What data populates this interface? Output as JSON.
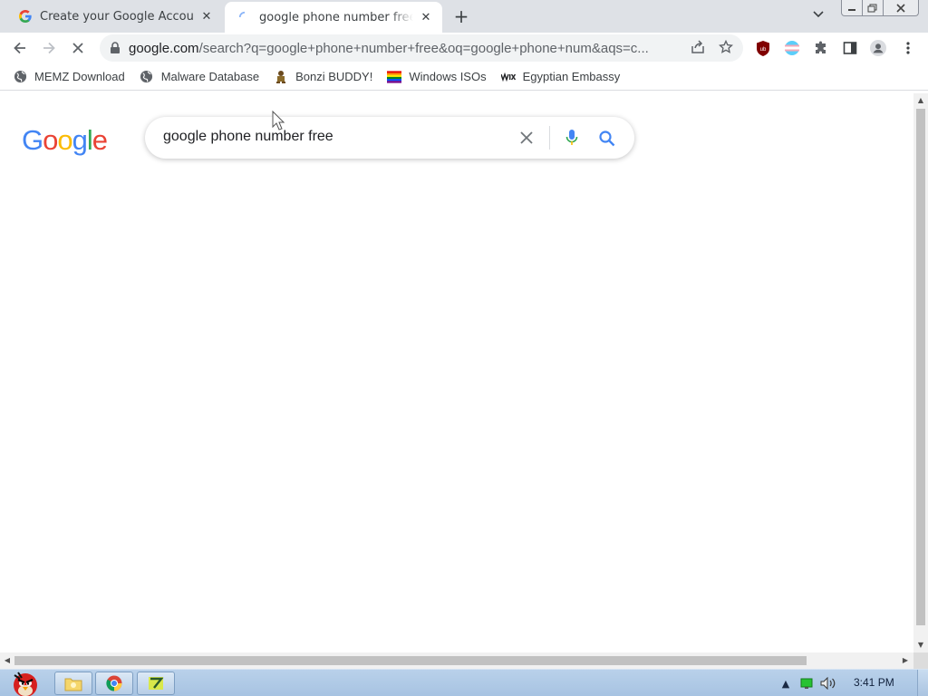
{
  "tabs": [
    {
      "title": "Create your Google Account",
      "active": false,
      "favicon": "google-g-icon"
    },
    {
      "title": "google phone number free - Google Search",
      "active": true,
      "favicon": "loading-spinner-icon"
    }
  ],
  "window_controls": {
    "minimize": "minimize-icon",
    "maximize": "restore-icon",
    "close": "close-icon"
  },
  "toolbar": {
    "url_host": "google.com",
    "url_rest": "/search?q=google+phone+number+free&oq=google+phone+num&aqs=c...",
    "back": "back-arrow-icon",
    "forward": "forward-arrow-icon",
    "reload": "stop-loading-icon"
  },
  "bookmarks": [
    {
      "label": "MEMZ Download",
      "icon": "globe-icon"
    },
    {
      "label": "Malware Database",
      "icon": "globe-icon"
    },
    {
      "label": "Bonzi BUDDY!",
      "icon": "bonzi-icon"
    },
    {
      "label": "Windows ISOs",
      "icon": "rainbow-flag-icon"
    },
    {
      "label": "Egyptian Embassy",
      "icon": "wix-icon"
    }
  ],
  "search": {
    "logo_text": "Google",
    "query": "google phone number free"
  },
  "taskbar": {
    "clock": "3:41 PM"
  },
  "colors": {
    "google_blue": "#4285f4",
    "google_red": "#ea4335",
    "google_yellow": "#fbbc05",
    "google_green": "#34a853",
    "tabstrip_bg": "#dee1e6"
  }
}
